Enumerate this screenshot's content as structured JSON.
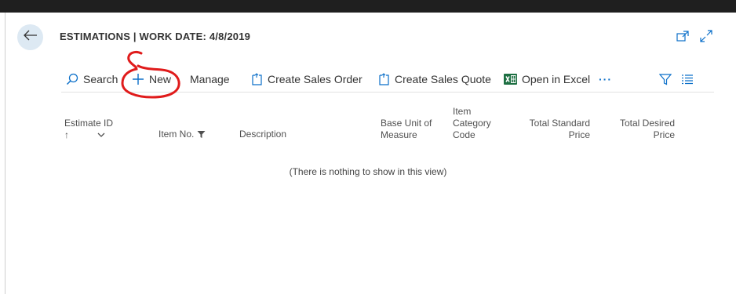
{
  "header": {
    "title": "ESTIMATIONS | WORK DATE: 4/8/2019",
    "back_icon": "arrow-left-icon",
    "popout_icon": "open-new-window-icon",
    "expand_icon": "expand-icon"
  },
  "actions": {
    "search": "Search",
    "new": "New",
    "manage": "Manage",
    "create_sales_order": "Create Sales Order",
    "create_sales_quote": "Create Sales Quote",
    "open_in_excel": "Open in Excel",
    "more": "···"
  },
  "columns": {
    "estimate_id": "Estimate ID",
    "sort_indicator": "↑",
    "item_no": "Item No.",
    "description": "Description",
    "base_unit_1": "Base Unit of",
    "base_unit_2": "Measure",
    "item_cat_1": "Item",
    "item_cat_2": "Category",
    "item_cat_3": "Code",
    "total_standard_1": "Total Standard",
    "total_standard_2": "Price",
    "total_desired_1": "Total Desired",
    "total_desired_2": "Price"
  },
  "list": {
    "empty_message": "(There is nothing to show in this view)"
  },
  "colors": {
    "accent": "#0b6fc9",
    "back_button_bg": "#dde9f3",
    "annotation_red": "#e01b1b",
    "excel_green": "#1d6f42"
  }
}
